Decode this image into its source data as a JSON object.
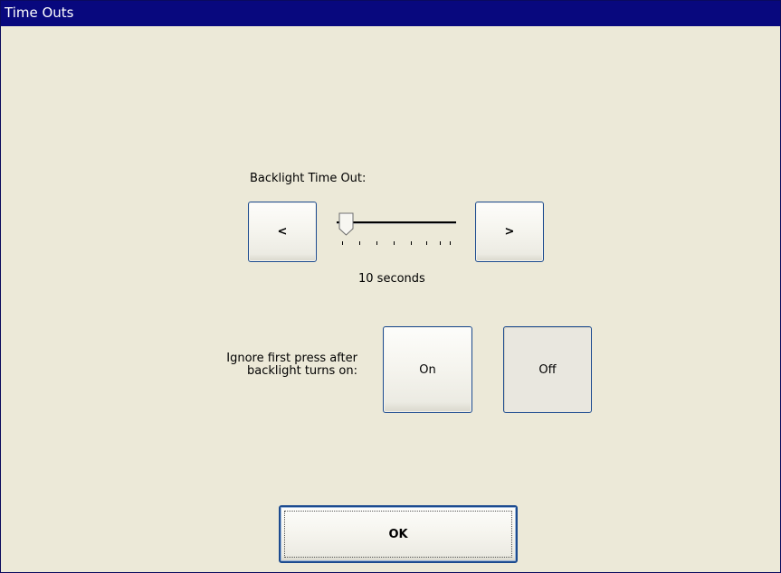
{
  "window": {
    "title": "Time Outs"
  },
  "backlight": {
    "label": "Backlight Time Out:",
    "decrease_label": "<",
    "increase_label": ">",
    "value_text": "10 seconds",
    "slider_position": 0
  },
  "ignore_press": {
    "label_line1": "Ignore first press after",
    "label_line2": "backlight turns on:",
    "on_label": "On",
    "off_label": "Off",
    "selected": "Off"
  },
  "ok_label": "OK",
  "colors": {
    "titlebar": "#08087e",
    "background": "#ece9d8",
    "button_border": "#1c4b8f"
  }
}
